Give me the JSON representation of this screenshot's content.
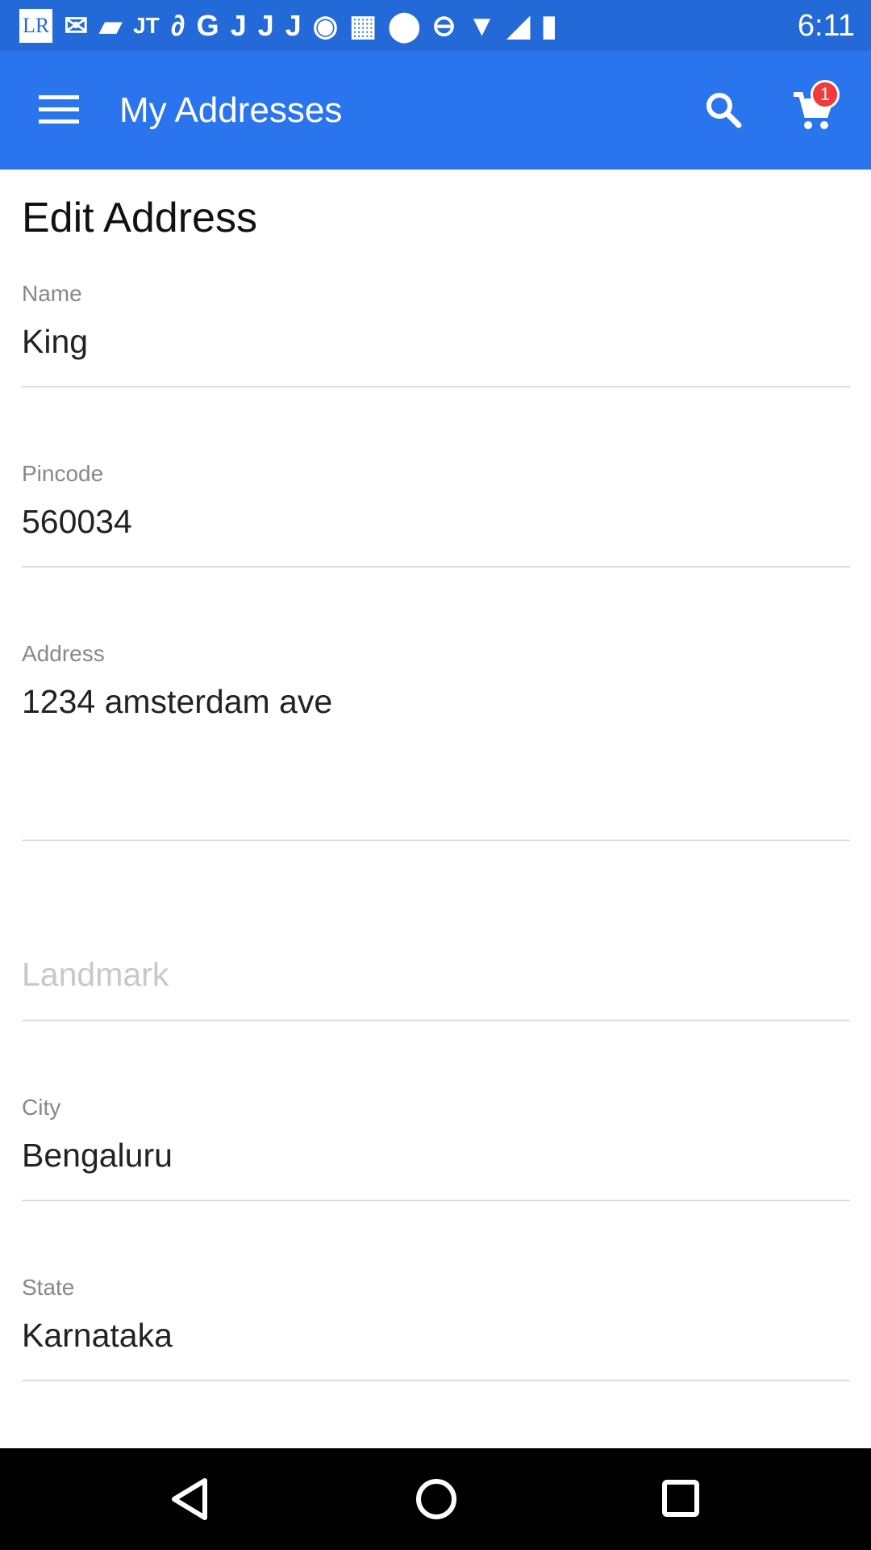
{
  "status_bar": {
    "time": "6:11",
    "icons": [
      "lr-icon",
      "gmail-icon",
      "tag-icon",
      "jt-icon",
      "link-icon",
      "google-icon",
      "j-icon",
      "j-icon",
      "j-icon",
      "target-icon",
      "grid-icon",
      "location-icon",
      "dnd-icon",
      "wifi-icon",
      "signal-icon",
      "battery-charging-icon"
    ]
  },
  "app_bar": {
    "title": "My Addresses",
    "cart_badge": "1"
  },
  "form": {
    "title": "Edit Address",
    "name": {
      "label": "Name",
      "value": "King"
    },
    "pincode": {
      "label": "Pincode",
      "value": "560034"
    },
    "address": {
      "label": "Address",
      "value": "1234 amsterdam ave"
    },
    "landmark": {
      "placeholder": "Landmark",
      "value": ""
    },
    "city": {
      "label": "City",
      "value": "Bengaluru"
    },
    "state": {
      "label": "State",
      "value": "Karnataka"
    }
  },
  "colors": {
    "app_bar": "#2a75ee",
    "status_bar": "#2469d8",
    "badge": "#f2393b"
  }
}
